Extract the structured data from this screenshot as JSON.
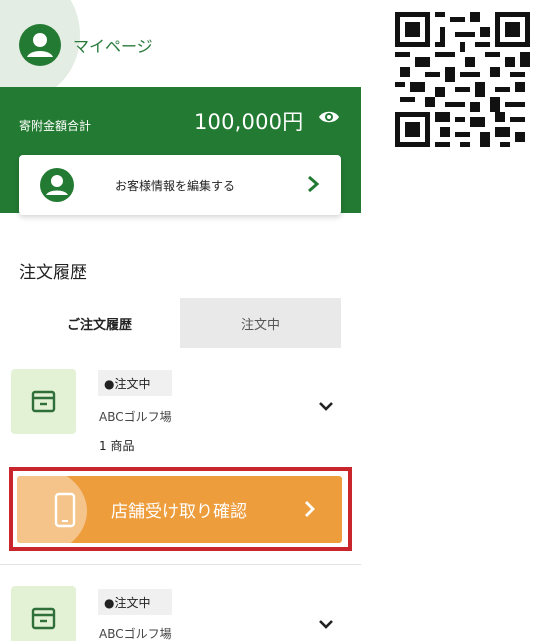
{
  "header": {
    "title": "マイページ",
    "user_icon": "user-circle-icon"
  },
  "donation": {
    "label": "寄附金額合計",
    "amount": "100,000円",
    "visibility_icon": "eye-icon"
  },
  "profile_card": {
    "label": "お客様情報を編集する",
    "icon": "user-circle-icon"
  },
  "orders_section": {
    "title": "注文履歴",
    "tabs": [
      {
        "label": "ご注文履歴",
        "active": true
      },
      {
        "label": "注文中",
        "active": false
      }
    ]
  },
  "orders": [
    {
      "status": "●注文中",
      "store": "ABCゴルフ場",
      "count": "1 商品",
      "icon": "box-icon"
    },
    {
      "status": "●注文中",
      "store": "ABCゴルフ場",
      "icon": "box-icon"
    }
  ],
  "pickup_button": {
    "label": "店舗受け取り確認",
    "icon": "smartphone-icon"
  },
  "colors": {
    "brand_green": "#237b33",
    "accent_orange": "#ee9d3d",
    "highlight_red": "#c8262c"
  }
}
